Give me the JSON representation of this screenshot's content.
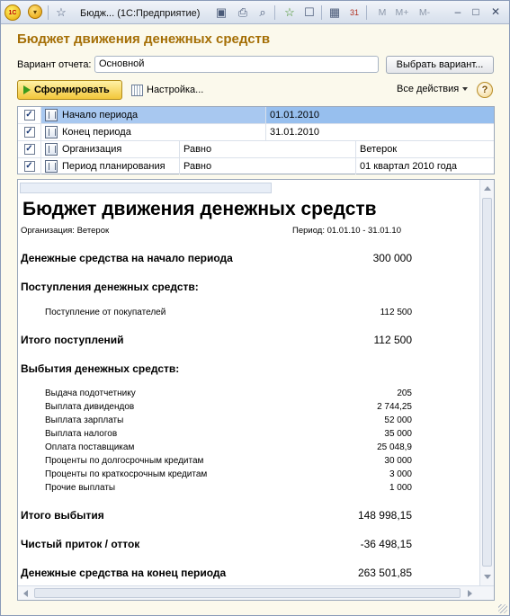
{
  "titlebar": {
    "logo": "1С",
    "title": "Бюдж... (1С:Предприятие)",
    "text_buttons": [
      "M",
      "M+",
      "M-"
    ],
    "icons": [
      "back-icon",
      "star-icon",
      "save-icon",
      "print-icon",
      "preview-icon",
      "favorite-add-icon",
      "history-icon",
      "calculator-icon",
      "calendar-icon",
      "minimize-icon",
      "maximize-icon",
      "close-icon"
    ]
  },
  "header": {
    "title": "Бюджет движения денежных средств",
    "variant_label": "Вариант отчета:",
    "variant_value": "Основной",
    "choose_variant": "Выбрать вариант..."
  },
  "toolbar": {
    "generate": "Сформировать",
    "settings": "Настройка...",
    "all_actions": "Все действия",
    "help": "?"
  },
  "settings_grid": [
    {
      "checked": true,
      "name": "Начало периода",
      "comparison": "",
      "value": "01.01.2010",
      "selected": true
    },
    {
      "checked": true,
      "name": "Конец периода",
      "comparison": "",
      "value": "31.01.2010",
      "selected": false
    },
    {
      "checked": true,
      "name": "Организация",
      "comparison": "Равно",
      "value": "Ветерок",
      "selected": false
    },
    {
      "checked": true,
      "name": "Период планирования",
      "comparison": "Равно",
      "value": "01 квартал 2010 года",
      "selected": false
    }
  ],
  "report": {
    "title": "Бюджет движения денежных средств",
    "organization": "Организация: Ветерок",
    "period": "Период: 01.01.10 - 31.01.10",
    "opening_label": "Денежные средства на начало периода",
    "opening_value": "300 000",
    "receipts_header": "Поступления денежных средств:",
    "receipts": [
      {
        "label": "Поступление от покупателей",
        "value": "112 500"
      }
    ],
    "receipts_total_label": "Итого поступлений",
    "receipts_total_value": "112 500",
    "payments_header": "Выбытия денежных средств:",
    "payments": [
      {
        "label": "Выдача подотчетнику",
        "value": "205"
      },
      {
        "label": "Выплата дивидендов",
        "value": "2 744,25"
      },
      {
        "label": "Выплата зарплаты",
        "value": "52 000"
      },
      {
        "label": "Выплата налогов",
        "value": "35 000"
      },
      {
        "label": "Оплата поставщикам",
        "value": "25 048,9"
      },
      {
        "label": "Проценты по долгосрочным кредитам",
        "value": "30 000"
      },
      {
        "label": "Проценты по краткосрочным кредитам",
        "value": "3 000"
      },
      {
        "label": "Прочие выплаты",
        "value": "1 000"
      }
    ],
    "payments_total_label": "Итого выбытия",
    "payments_total_value": "148 998,15",
    "net_label": "Чистый приток / отток",
    "net_value": "-36 498,15",
    "closing_label": "Денежные средства на конец периода",
    "closing_value": "263 501,85"
  }
}
